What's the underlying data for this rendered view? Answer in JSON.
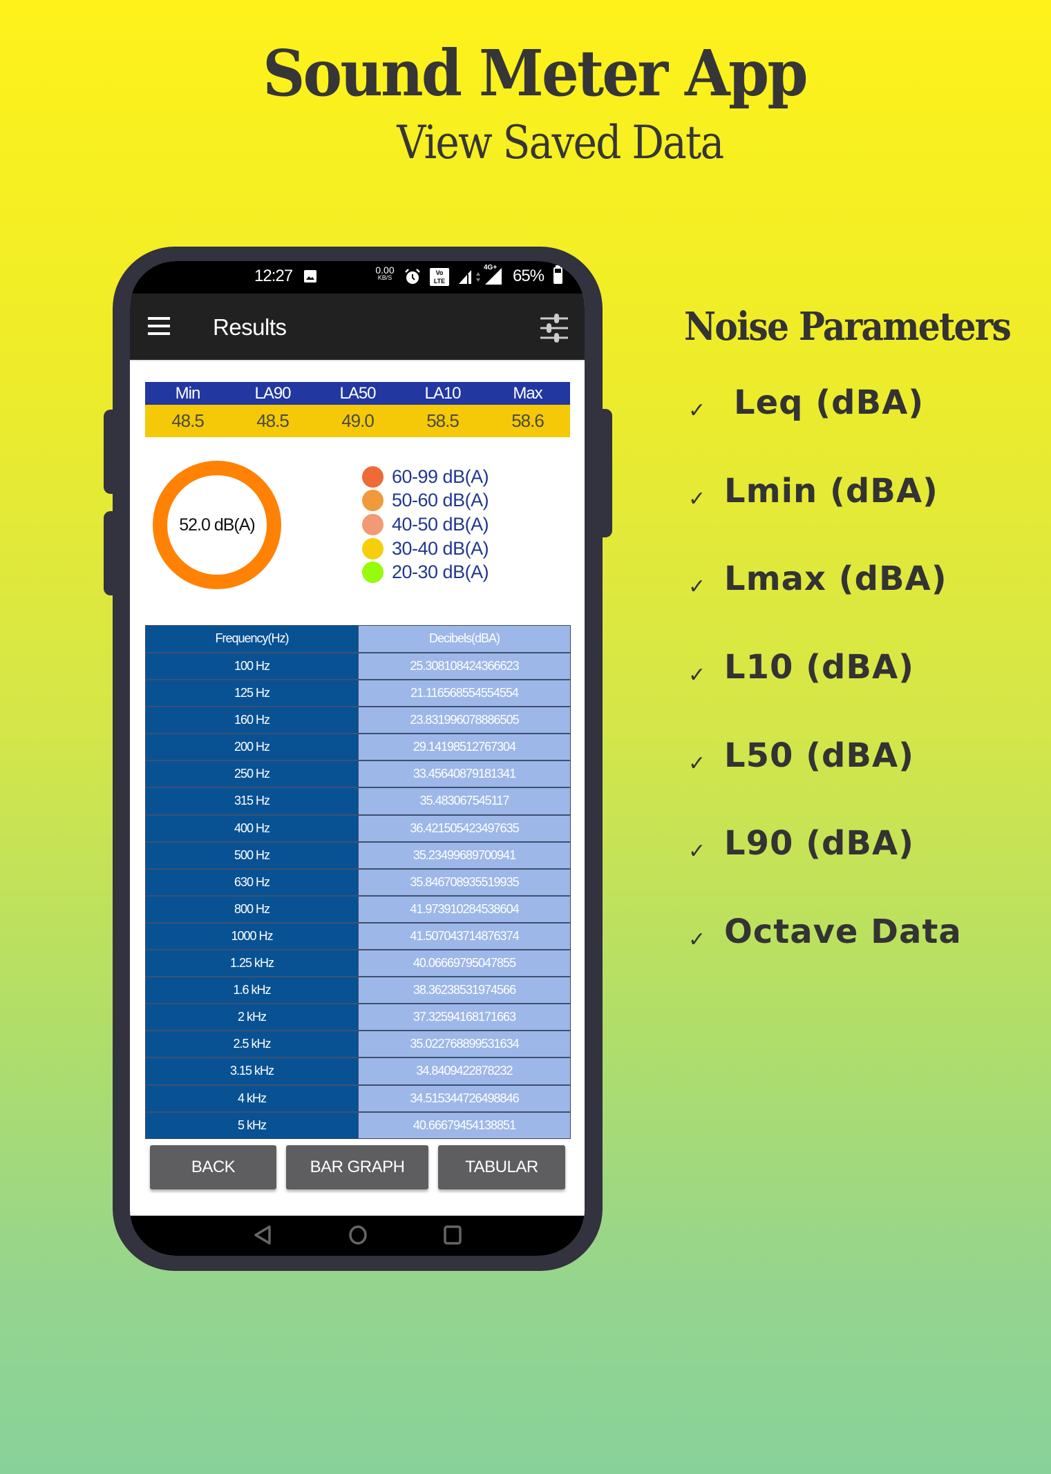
{
  "header": {
    "title": "Sound Meter App",
    "subtitle": "View Saved Data"
  },
  "status_bar": {
    "time": "12:27",
    "net_speed": "0.00",
    "net_unit": "KB/S",
    "volte_top": "Vo LTE",
    "network": "4G+",
    "battery": "65%"
  },
  "app_bar": {
    "title": "Results"
  },
  "stats": {
    "headers": [
      "Min",
      "LA90",
      "LA50",
      "LA10",
      "Max"
    ],
    "values": [
      "48.5",
      "48.5",
      "49.0",
      "58.5",
      "58.6"
    ]
  },
  "gauge": {
    "label": "52.0 dB(A)",
    "value": 52.0,
    "ring_color": "#FF8204"
  },
  "legend": [
    {
      "label": "60-99 dB(A)",
      "color": "#EE6A36"
    },
    {
      "label": "50-60 dB(A)",
      "color": "#F19A3C"
    },
    {
      "label": "40-50 dB(A)",
      "color": "#F19A74"
    },
    {
      "label": "30-40 dB(A)",
      "color": "#F5CF0B"
    },
    {
      "label": "20-30 dB(A)",
      "color": "#96FB0C"
    }
  ],
  "frequency_table": {
    "headers": [
      "Frequency(Hz)",
      "Decibels(dBA)"
    ],
    "rows": [
      [
        "100 Hz",
        "25.308108424366623"
      ],
      [
        "125 Hz",
        "21.116568554554554"
      ],
      [
        "160 Hz",
        "23.831996078886505"
      ],
      [
        "200 Hz",
        "29.14198512767304"
      ],
      [
        "250 Hz",
        "33.45640879181341"
      ],
      [
        "315 Hz",
        "35.483067545117"
      ],
      [
        "400 Hz",
        "36.421505423497635"
      ],
      [
        "500 Hz",
        "35.23499689700941"
      ],
      [
        "630 Hz",
        "35.846708935519935"
      ],
      [
        "800 Hz",
        "41.973910284538604"
      ],
      [
        "1000 Hz",
        "41.507043714876374"
      ],
      [
        "1.25 kHz",
        "40.06669795047855"
      ],
      [
        "1.6 kHz",
        "38.36238531974566"
      ],
      [
        "2 kHz",
        "37.32594168171663"
      ],
      [
        "2.5 kHz",
        "35.022768899531634"
      ],
      [
        "3.15 kHz",
        "34.8409422878232"
      ],
      [
        "4 kHz",
        "34.515344726498846"
      ],
      [
        "5 kHz",
        "40.66679454138851"
      ]
    ]
  },
  "buttons": {
    "back": "BACK",
    "bar_graph": "BAR GRAPH",
    "tabular": "TABULAR"
  },
  "noise_parameters": {
    "title": "Noise Parameters",
    "check_glyph": "✓",
    "items": [
      "Leq (dBA)",
      "Lmin (dBA)",
      "Lmax (dBA)",
      "L10 (dBA)",
      "L50 (dBA)",
      "L90 (dBA)",
      "Octave Data"
    ]
  }
}
